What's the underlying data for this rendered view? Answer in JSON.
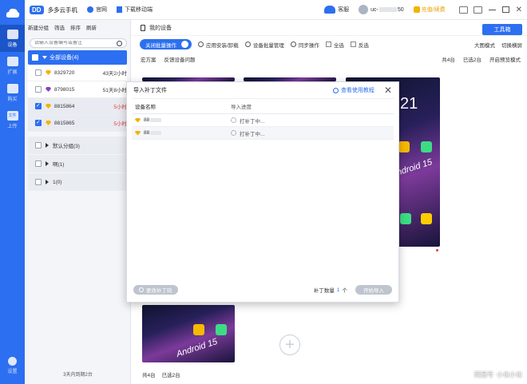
{
  "app": {
    "logo": "DD",
    "name": "多多云手机"
  },
  "topbar": {
    "links": [
      "官网",
      "下载移动端"
    ],
    "service": "客服",
    "user_prefix": "uc-",
    "user_suffix": "50",
    "vip": "充值/续费"
  },
  "rail": {
    "items": [
      {
        "label": "设备",
        "icon": "cloud-device-icon"
      },
      {
        "label": "扩展",
        "icon": "apps-grid-icon"
      },
      {
        "label": "购买",
        "icon": "cart-icon"
      },
      {
        "label": "上传",
        "icon": "upload-file-icon"
      }
    ],
    "file_label": "文件",
    "settings": "设置"
  },
  "sidebar": {
    "tools": [
      "新建分组",
      "筛选",
      "排序",
      "刷新"
    ],
    "search_placeholder": "请输入设备编号或备注",
    "all_devices": "全部设备(4)",
    "devices": [
      {
        "id": "8329720",
        "time": "43天2小时",
        "red": false,
        "checked": false,
        "gem": "#f2b400"
      },
      {
        "id": "8798015",
        "time": "51天8小时",
        "red": false,
        "checked": false,
        "gem": "#8b3bd1"
      },
      {
        "id": "8815864",
        "time": "5小时",
        "red": true,
        "checked": true,
        "gem": "#f2b400"
      },
      {
        "id": "8815865",
        "time": "5小时",
        "red": true,
        "checked": true,
        "gem": "#f2b400"
      }
    ],
    "groups": [
      "默认分组(3)",
      "啊(1)",
      "1(0)"
    ],
    "expiry_prefix": "3天内到期",
    "expiry_count": "2",
    "expiry_unit": "台"
  },
  "main": {
    "my_devices": "我的设备",
    "toolbox": "工具箱",
    "batch_toggle": "关闭批量操作",
    "actions": [
      "应用安装/卸载",
      "设备批量管理",
      "同步操作",
      "全选",
      "反选"
    ],
    "view_mode": "大图模式",
    "switch_screen": "切换横屏",
    "secondary": [
      "宏方案",
      "反馈设备问题"
    ],
    "total": "共4台",
    "selected": "已选2台",
    "preview": "开启预览模式",
    "card_clock": "21",
    "card_android": "Android 15",
    "bottom_total": "共4台",
    "bottom_selected": "已选2台"
  },
  "modal": {
    "title": "导入补丁文件",
    "help": "查看使用教程",
    "col_name": "设备名称",
    "col_progress": "导入进度",
    "rows": [
      {
        "prefix": "88",
        "progress": "打补丁中..."
      },
      {
        "prefix": "88",
        "progress": "打补丁中..."
      }
    ],
    "change_btn": "更改补丁码",
    "count_label": "补丁数量",
    "count": "1",
    "count_unit": "个",
    "start_btn": "开始导入"
  },
  "watermark": [
    "网易号",
    "小也小也"
  ]
}
